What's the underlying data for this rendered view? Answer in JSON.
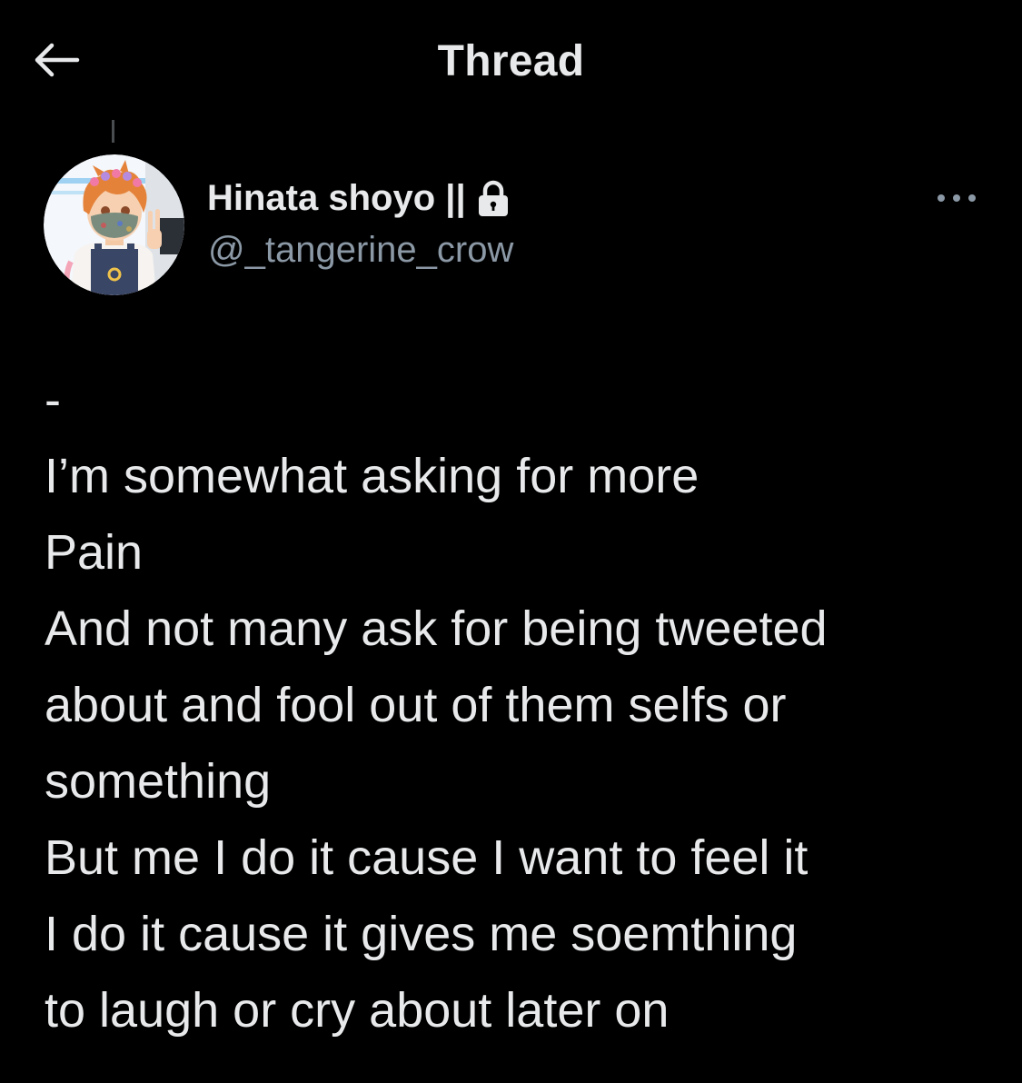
{
  "header": {
    "title": "Thread",
    "back_icon": "arrow-left-icon"
  },
  "tweet": {
    "author": {
      "display_name": "Hinata shoyo ||",
      "handle": "@_tangerine_crow",
      "protected_icon": "lock-icon",
      "avatar_icon": "avatar-illustration"
    },
    "more_icon": "more-horizontal-icon",
    "lines": [
      "-",
      "I’m somewhat asking for more",
      "Pain",
      "And not many ask for being tweeted",
      "about and fool out of them selfs or",
      "something",
      "But me I do it cause I want to feel it",
      "I do it cause it gives me soemthing",
      "to laugh or cry about later on"
    ]
  },
  "colors": {
    "background": "#000000",
    "primary_text": "#e7e9ea",
    "secondary_text": "#8b98a5",
    "thread_line": "#4a4d50"
  }
}
